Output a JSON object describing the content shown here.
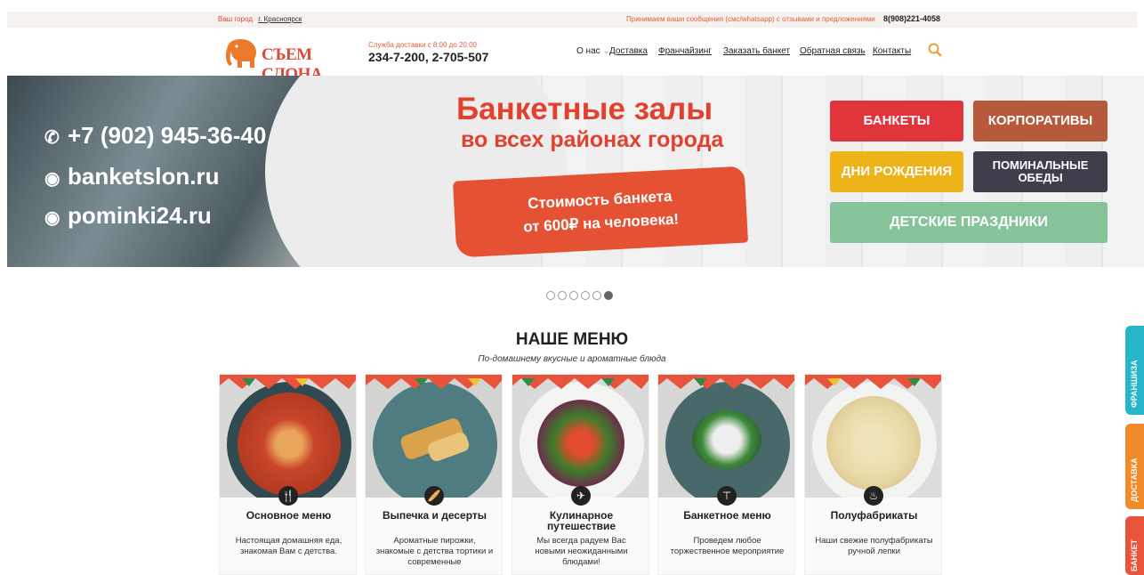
{
  "topbar": {
    "city_label": "Ваш город",
    "city_value": "г. Красноярск",
    "message": "Принимаем ваши сообщения (смс/whatsapp) с отзывами и предложениями",
    "phone": "8(908)221-4058"
  },
  "header": {
    "logo_text": "СЪЕМ СЛОНА",
    "delivery_hours": "Служба доставки с 8:00 до 20:00",
    "delivery_phones": "234-7-200, 2-705-507",
    "nav": [
      {
        "label": "О нас"
      },
      {
        "label": "Доставка"
      },
      {
        "label": "Франчайзинг"
      },
      {
        "label": "Заказать банкет"
      },
      {
        "label": "Обратная связь"
      },
      {
        "label": "Контакты"
      }
    ],
    "accent": "#e8a23a"
  },
  "banner": {
    "phone": "+7 (902) 945-36-40",
    "site1": "banketslon.ru",
    "site2": "pominki24.ru",
    "title": "Банкетные залы",
    "subtitle": "во всех районах города",
    "promo_line1": "Стоимость банкета",
    "promo_line2": "от 600₽ на человека!",
    "tiles": [
      {
        "label": "БАНКЕТЫ",
        "color": "#e0353b"
      },
      {
        "label": "КОРПОРАТИВЫ",
        "color": "#b75a3c"
      },
      {
        "label": "ДНИ РОЖДЕНИЯ",
        "color": "#efb31a"
      },
      {
        "label": "ПОМИНАЛЬНЫЕ ОБЕДЫ",
        "color": "#3e3f4a"
      },
      {
        "label": "ДЕТСКИЕ ПРАЗДНИКИ",
        "color": "#86c29a"
      }
    ]
  },
  "slider": {
    "count": 6,
    "active_index": 6
  },
  "menu": {
    "title": "НАШЕ МЕНЮ",
    "subtitle": "По-домашнему вкусные и ароматные блюда",
    "cards": [
      {
        "name": "Основное меню",
        "desc": "Настоящая домашняя еда, знакомая Вам с детства.",
        "icon": "cutlery-icon"
      },
      {
        "name": "Выпечка и десерты",
        "desc": "Ароматные пирожки, знакомые с детства тортики и современные",
        "icon": "baguette-icon"
      },
      {
        "name": "Кулинарное путешествие",
        "desc": "Мы всегда радуем Вас новыми неожиданными блюдами!",
        "icon": "plane-icon"
      },
      {
        "name": "Банкетное меню",
        "desc": "Проведем любое торжественное мероприятие",
        "icon": "corkscrew-icon"
      },
      {
        "name": "Полуфабрикаты",
        "desc": "Наши свежие полуфабрикаты ручной лепки",
        "icon": "pot-icon"
      }
    ]
  },
  "side_tabs": [
    {
      "label": "ФРАНШИЗА",
      "color": "#27b6c9"
    },
    {
      "label": "ДОСТАВКА",
      "color": "#f08a2b"
    },
    {
      "label": "БАНКЕТ",
      "color": "#e8533a"
    }
  ]
}
